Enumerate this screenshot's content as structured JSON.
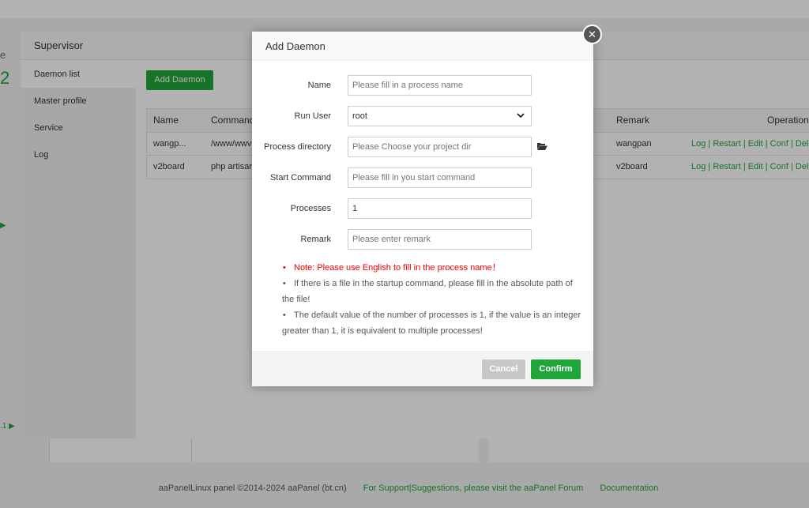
{
  "background": {
    "left_fragment_letter": "e",
    "left_fragment_number": "2",
    "left_fragment_version": ".1 ▶",
    "left_fragment_arrow": "▶"
  },
  "supervisor": {
    "title": "Supervisor",
    "menu": [
      {
        "label": "Daemon list",
        "active": true
      },
      {
        "label": "Master profile",
        "active": false
      },
      {
        "label": "Service",
        "active": false
      },
      {
        "label": "Log",
        "active": false
      }
    ],
    "add_button": "Add Daemon",
    "table": {
      "headers": {
        "name": "Name",
        "command": "Command",
        "remark": "Remark",
        "operation": "Operation"
      },
      "rows": [
        {
          "name": "wangp...",
          "command": "/www/wwv",
          "remark": "wangpan",
          "operation": "Log | Restart | Edit | Conf | Del"
        },
        {
          "name": "v2board",
          "command": "php artisar",
          "remark": "v2board",
          "operation": "Log | Restart | Edit | Conf | Del"
        }
      ]
    }
  },
  "dialog": {
    "title": "Add Daemon",
    "close_glyph": "✕",
    "fields": {
      "name": {
        "label": "Name",
        "placeholder": "Please fill in a process name",
        "value": ""
      },
      "run_user": {
        "label": "Run User",
        "value": "root"
      },
      "process_directory": {
        "label": "Process directory",
        "placeholder": "Please Choose your project dir",
        "value": ""
      },
      "start_command": {
        "label": "Start Command",
        "placeholder": "Please fill in you start command",
        "value": ""
      },
      "processes": {
        "label": "Processes",
        "value": "1"
      },
      "remark": {
        "label": "Remark",
        "placeholder": "Please enter remark",
        "value": ""
      }
    },
    "notes": {
      "bullet": "•",
      "note1": "Note: Please use English to fill in the process name！",
      "note2": "If there is a file in the startup command, please fill in the absolute path of the file!",
      "note3": "The default value of the number of processes is 1, if the value is an integer greater than 1, it is equivalent to multiple processes!"
    },
    "cancel": "Cancel",
    "confirm": "Confirm",
    "accent_color": "#20a53a",
    "warning_color": "#ee0000"
  },
  "footer": {
    "copyright": "aaPanelLinux panel ©2014-2024 aaPanel (bt.cn)",
    "support": "For Support|Suggestions, please visit the aaPanel Forum",
    "docs": "Documentation"
  }
}
